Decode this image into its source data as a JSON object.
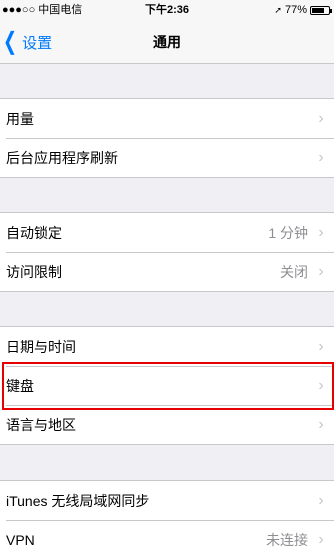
{
  "status": {
    "carrier": "●●●○○ 中国电信",
    "wifi_icon": "wifi-icon",
    "time": "下午2:36",
    "location_icon": "location-arrow-icon",
    "battery_percent": "77%",
    "battery_level": 0.77
  },
  "nav": {
    "back_label": "设置",
    "title": "通用"
  },
  "groups": [
    {
      "rows": [
        {
          "label": "用量",
          "value": ""
        },
        {
          "label": "后台应用程序刷新",
          "value": ""
        }
      ]
    },
    {
      "rows": [
        {
          "label": "自动锁定",
          "value": "1 分钟"
        },
        {
          "label": "访问限制",
          "value": "关闭"
        }
      ]
    },
    {
      "rows": [
        {
          "label": "日期与时间",
          "value": ""
        },
        {
          "label": "键盘",
          "value": ""
        },
        {
          "label": "语言与地区",
          "value": ""
        }
      ]
    },
    {
      "rows": [
        {
          "label": "iTunes 无线局域网同步",
          "value": ""
        },
        {
          "label": "VPN",
          "value": "未连接"
        }
      ]
    }
  ],
  "highlight_color": "#e60000",
  "accent_color": "#007aff"
}
